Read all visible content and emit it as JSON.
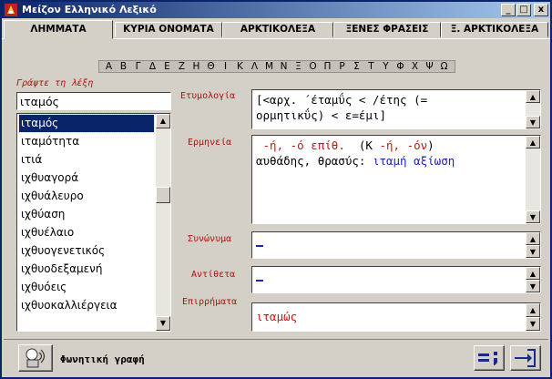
{
  "window": {
    "title": "Μείζον Ελληνικό Λεξικό",
    "controls": {
      "minimize": "_",
      "maximize": "□",
      "close": "x"
    }
  },
  "tabs": [
    {
      "label": "ΛΗΜΜΑΤΑ",
      "active": true
    },
    {
      "label": "ΚΥΡΙΑ ΟΝΟΜΑΤΑ"
    },
    {
      "label": "ΑΡΚΤΙΚΟΛΕΞΑ"
    },
    {
      "label": "ΞΕΝΕΣ ΦΡΑΣΕΙΣ"
    },
    {
      "label": "Ξ. ΑΡΚΤΙΚΟΛΕΞΑ"
    }
  ],
  "alphabet": [
    "Α",
    "Β",
    "Γ",
    "Δ",
    "Ε",
    "Ζ",
    "Η",
    "Θ",
    "Ι",
    "Κ",
    "Λ",
    "Μ",
    "Ν",
    "Ξ",
    "Ο",
    "Π",
    "Ρ",
    "Σ",
    "Τ",
    "Υ",
    "Φ",
    "Χ",
    "Ψ",
    "Ω"
  ],
  "search": {
    "label": "Γράψτε τη λέξη",
    "value": "ιταμός"
  },
  "word_list": {
    "items": [
      "ιταμός",
      "ιταμότητα",
      "ιτιά",
      "ιχθυαγορά",
      "ιχθυάλευρο",
      "ιχθύαση",
      "ιχθυέλαιο",
      "ιχθυογενετικός",
      "ιχθυοδεξαμενή",
      "ιχθυόεις",
      "ιχθυοκαλλιέργεια"
    ],
    "selected_index": 0
  },
  "fields": {
    "etymology": {
      "label": "Ετυμολογία",
      "line1": "[<αρχ. ΄έταμΰς < /έτης (=",
      "line2": "ορμητικΰς) < ε=έμι]"
    },
    "meaning": {
      "label": "Ερμηνεία",
      "line1_red": " -ή, -ό επίθ.",
      "line1_black_mid": "  (Κ ",
      "line1_red2": "-ή, -όν",
      "line1_black_end": ")",
      "line2_black": "αυθάδης, θρασύς: ",
      "line2_blue": "ιταμή αξίωση"
    },
    "synonyms": {
      "label": "Συνώνυμα",
      "value": ""
    },
    "antonyms": {
      "label": "Αντίθετα",
      "value": ""
    },
    "adverbs": {
      "label": "Επιρρήματα",
      "value": "ιταμώς"
    }
  },
  "footer": {
    "phonetic_label": "Φωνητική γραφή",
    "equals_button": "=;",
    "exit_button": "→|"
  }
}
